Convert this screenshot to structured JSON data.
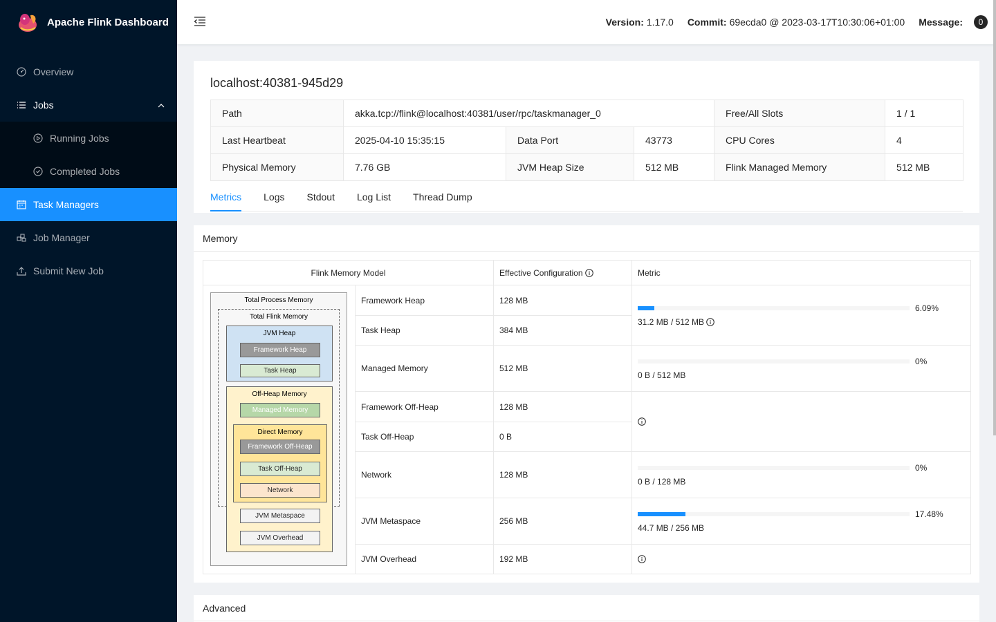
{
  "brand": {
    "title": "Apache Flink Dashboard"
  },
  "sidebar": {
    "items": [
      {
        "label": "Overview",
        "icon": "dashboard-icon"
      },
      {
        "label": "Jobs",
        "icon": "list-icon"
      },
      {
        "label": "Running Jobs",
        "icon": "play-circle-icon"
      },
      {
        "label": "Completed Jobs",
        "icon": "check-circle-icon"
      },
      {
        "label": "Task Managers",
        "icon": "schedule-icon"
      },
      {
        "label": "Job Manager",
        "icon": "cluster-icon"
      },
      {
        "label": "Submit New Job",
        "icon": "upload-icon"
      }
    ]
  },
  "header": {
    "version_label": "Version:",
    "version": "1.17.0",
    "commit_label": "Commit:",
    "commit": "69ecda0 @ 2023-03-17T10:30:06+01:00",
    "message_label": "Message:",
    "message_count": "0"
  },
  "taskmanager": {
    "title": "localhost:40381-945d29",
    "path_label": "Path",
    "path": "akka.tcp://flink@localhost:40381/user/rpc/taskmanager_0",
    "slots_label": "Free/All Slots",
    "slots": "1 / 1",
    "heartbeat_label": "Last Heartbeat",
    "heartbeat": "2025-04-10 15:35:15",
    "dataport_label": "Data Port",
    "dataport": "43773",
    "cpu_label": "CPU Cores",
    "cpu": "4",
    "physmem_label": "Physical Memory",
    "physmem": "7.76 GB",
    "jvmheap_label": "JVM Heap Size",
    "jvmheap": "512 MB",
    "managed_label": "Flink Managed Memory",
    "managed": "512 MB"
  },
  "tabs": [
    "Metrics",
    "Logs",
    "Stdout",
    "Log List",
    "Thread Dump"
  ],
  "memory": {
    "title": "Memory",
    "col_model": "Flink Memory Model",
    "col_config": "Effective Configuration",
    "col_metric": "Metric",
    "rows": [
      {
        "name": "Framework Heap",
        "config": "128 MB"
      },
      {
        "name": "Task Heap",
        "config": "384 MB"
      },
      {
        "name": "Managed Memory",
        "config": "512 MB"
      },
      {
        "name": "Framework Off-Heap",
        "config": "128 MB"
      },
      {
        "name": "Task Off-Heap",
        "config": "0 B"
      },
      {
        "name": "Network",
        "config": "128 MB"
      },
      {
        "name": "JVM Metaspace",
        "config": "256 MB"
      },
      {
        "name": "JVM Overhead",
        "config": "192 MB"
      }
    ],
    "metrics": {
      "heap": {
        "pct": "6.09%",
        "fraction": 0.0609,
        "usage": "31.2 MB / 512 MB"
      },
      "managed": {
        "pct": "0%",
        "fraction": 0,
        "usage": "0 B / 512 MB"
      },
      "network": {
        "pct": "0%",
        "fraction": 0,
        "usage": "0 B / 128 MB"
      },
      "metaspace": {
        "pct": "17.48%",
        "fraction": 0.1748,
        "usage": "44.7 MB / 256 MB"
      }
    },
    "diagram": {
      "total_process": "Total Process Memory",
      "total_flink": "Total Flink Memory",
      "jvm_heap": "JVM Heap",
      "framework_heap": "Framework Heap",
      "task_heap": "Task Heap",
      "off_heap": "Off-Heap Memory",
      "managed": "Managed Memory",
      "direct": "Direct Memory",
      "framework_offheap": "Framework Off-Heap",
      "task_offheap": "Task Off-Heap",
      "network": "Network",
      "metaspace": "JVM Metaspace",
      "overhead": "JVM Overhead"
    }
  },
  "advanced": {
    "title": "Advanced"
  },
  "colors": {
    "primary": "#1890ff",
    "sidebar": "#001529"
  }
}
